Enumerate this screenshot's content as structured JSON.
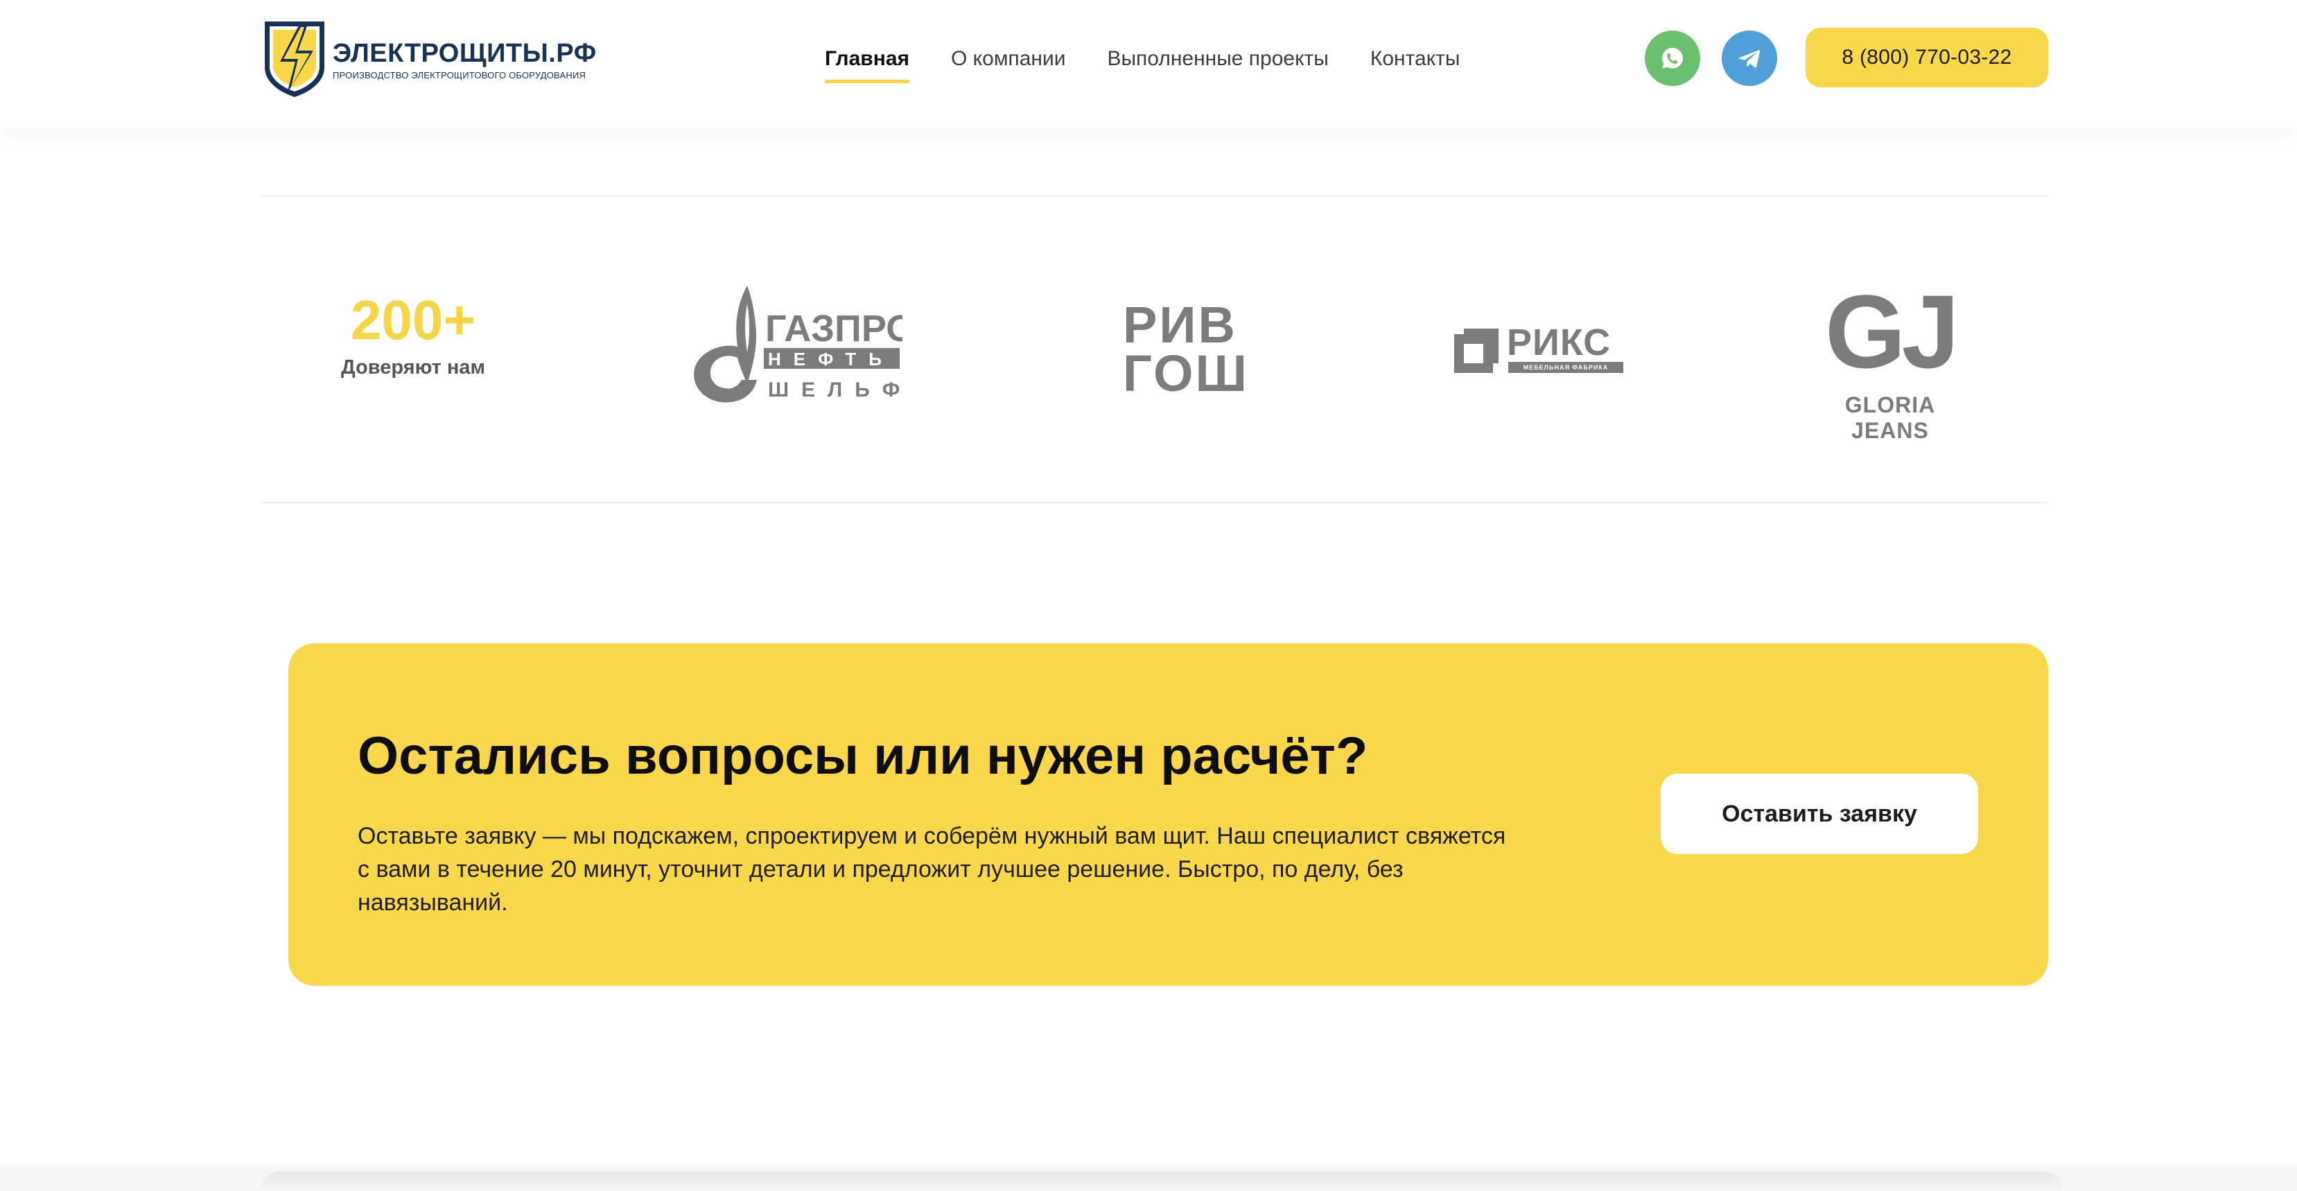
{
  "brand": {
    "name": "ЭЛЕКТРОЩИТЫ.РФ",
    "tagline": "производство электрощитового оборудования",
    "colors": {
      "accent": "#f8d74a",
      "navy": "#163257"
    }
  },
  "nav": {
    "items": [
      {
        "label": "Главная",
        "active": true
      },
      {
        "label": "О компании",
        "active": false
      },
      {
        "label": "Выполненные проекты",
        "active": false
      },
      {
        "label": "Контакты",
        "active": false
      }
    ]
  },
  "contacts": {
    "whatsapp_icon": "whatsapp-icon",
    "telegram_icon": "telegram-icon",
    "whatsapp_color": "#6bbf6e",
    "telegram_color": "#4f9fd8",
    "phone": "8 (800) 770-03-22"
  },
  "clients": {
    "stat": {
      "value": "200+",
      "label": "Доверяют нам"
    },
    "logos": {
      "gazprom": {
        "line1": "ГАЗПРОМ",
        "line2": "НЕФТЬ",
        "line3": "ШЕЛЬФ"
      },
      "rivgosh": {
        "line1": "РИВ",
        "line2": "ГОШ"
      },
      "riks": {
        "name": "РИКС",
        "sub": "мебельная фабрика"
      },
      "gj": {
        "mark": "GJ",
        "name": "GLORIA JEANS"
      }
    }
  },
  "cta": {
    "title": "Остались вопросы или нужен расчёт?",
    "text": "Оставьте заявку — мы подскажем, спроектируем и соберём нужный вам щит. Наш специалист свяжется с вами в течение 20 минут, уточнит детали и предложит лучшее решение. Быстро, по делу, без навязываний.",
    "button": "Оставить заявку"
  }
}
